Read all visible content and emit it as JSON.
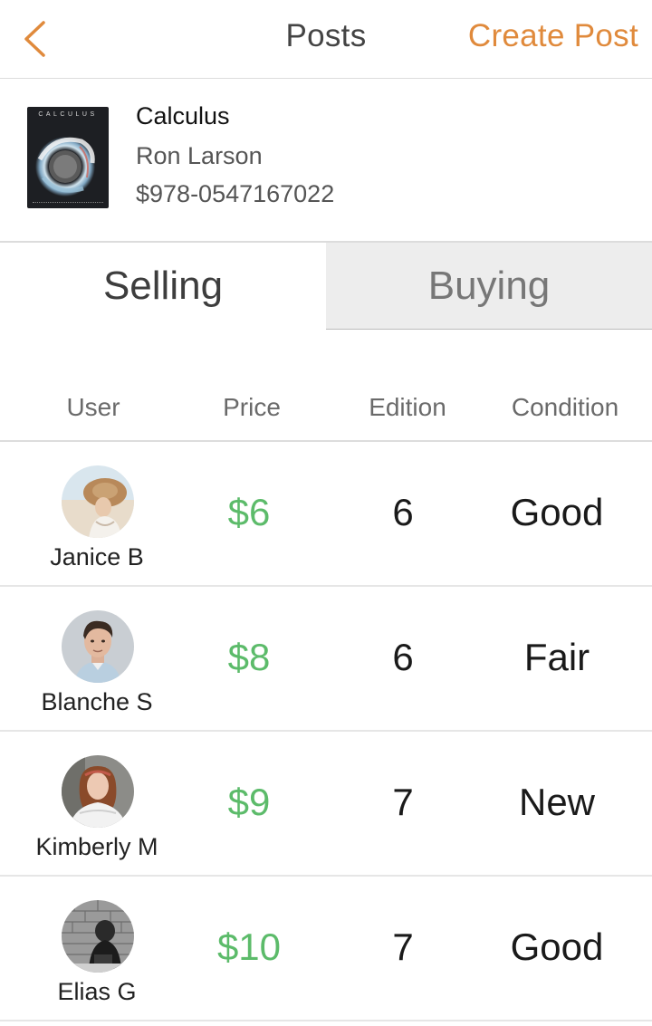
{
  "colors": {
    "accent": "#E08A3C",
    "price": "#5CBB6A",
    "tab_inactive_bg": "#EDEDED"
  },
  "header": {
    "back_icon": "chevron-left-icon",
    "title": "Posts",
    "create_post_label": "Create Post"
  },
  "book": {
    "cover_text": "CALCULUS",
    "title": "Calculus",
    "author": "Ron Larson",
    "isbn": "$978-0547167022"
  },
  "tabs": [
    {
      "label": "Selling",
      "selected": true
    },
    {
      "label": "Buying",
      "selected": false
    }
  ],
  "table": {
    "columns": [
      "User",
      "Price",
      "Edition",
      "Condition"
    ],
    "rows": [
      {
        "user": "Janice B",
        "price": "$6",
        "edition": "6",
        "condition": "Good"
      },
      {
        "user": "Blanche S",
        "price": "$8",
        "edition": "6",
        "condition": "Fair"
      },
      {
        "user": "Kimberly M",
        "price": "$9",
        "edition": "7",
        "condition": "New"
      },
      {
        "user": "Elias G",
        "price": "$10",
        "edition": "7",
        "condition": "Good"
      }
    ]
  }
}
